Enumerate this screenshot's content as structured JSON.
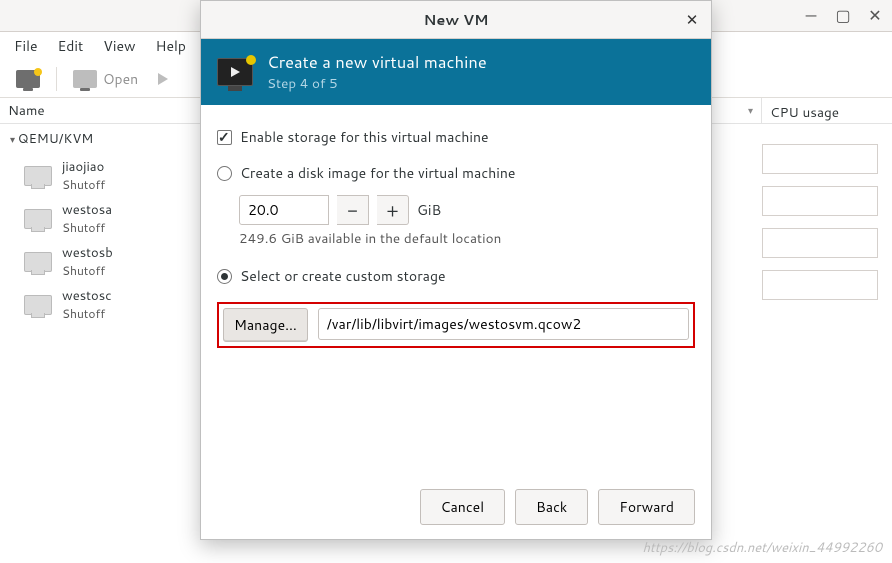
{
  "menubar": {
    "file": "File",
    "edit": "Edit",
    "view": "View",
    "help": "Help"
  },
  "toolbar": {
    "open_label": "Open"
  },
  "columns": {
    "name": "Name",
    "cpu": "CPU usage"
  },
  "tree": {
    "connection": "QEMU/KVM",
    "vms": [
      {
        "name": "jiaojiao",
        "state": "Shutoff"
      },
      {
        "name": "westosa",
        "state": "Shutoff"
      },
      {
        "name": "westosb",
        "state": "Shutoff"
      },
      {
        "name": "westosc",
        "state": "Shutoff"
      }
    ]
  },
  "dialog": {
    "window_title": "New VM",
    "header_title": "Create a new virtual machine",
    "header_subtitle": "Step 4 of 5",
    "enable_storage_label": "Enable storage for this virtual machine",
    "create_disk_label": "Create a disk image for the virtual machine",
    "disk_size": "20.0",
    "size_unit": "GiB",
    "available_text": "249.6 GiB available in the default location",
    "custom_storage_label": "Select or create custom storage",
    "manage_label": "Manage...",
    "storage_path": "/var/lib/libvirt/images/westosvm.qcow2",
    "cancel": "Cancel",
    "back": "Back",
    "forward": "Forward"
  },
  "watermark": "https://blog.csdn.net/weixin_44992260"
}
